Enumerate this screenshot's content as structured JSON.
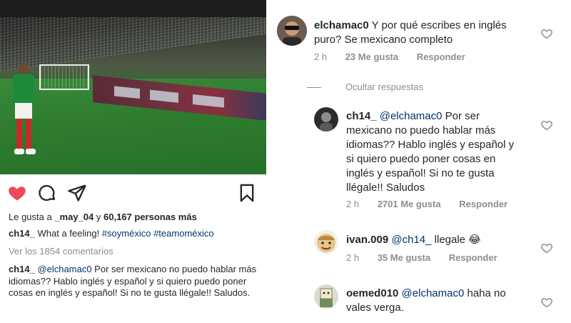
{
  "post": {
    "likes_prefix": "Le gusta a ",
    "likes_user": "_may_04",
    "likes_mid": " y ",
    "likes_count": "60,167 personas más",
    "caption_user": "ch14_",
    "caption_text": " What a feeling! ",
    "caption_tags": "#soyméxico #teamoméxico",
    "view_comments": "Ver los 1854 comentarios",
    "comment_user": "ch14_",
    "comment_mention": " @elchamac0",
    "comment_text": " Por ser mexicano no puedo hablar más idiomas?? Hablo inglés y español y si quiero puedo poner cosas en inglés y español! Si no te gusta llégale!! Saludos."
  },
  "icons": {
    "like": "heart-icon",
    "comment": "comment-icon",
    "share": "send-icon",
    "save": "bookmark-icon"
  },
  "colors": {
    "like_red": "#ed4956",
    "mention_blue": "#003569",
    "meta_gray": "#8e8e8e"
  },
  "comments": [
    {
      "user": "elchamac0",
      "text": " Y por qué escribes en inglés puro? Se mexicano completo",
      "time": "2 h",
      "likes": "23 Me gusta",
      "reply": "Responder"
    }
  ],
  "hide_replies": "Ocultar respuestas",
  "replies": [
    {
      "user": "ch14_",
      "mention": " @elchamac0",
      "text": " Por ser mexicano no puedo hablar más idiomas?? Hablo inglés y español y si quiero puedo poner cosas en inglés y español! Si no te gusta llégale!! Saludos",
      "time": "2 h",
      "likes": "2701 Me gusta",
      "reply": "Responder"
    },
    {
      "user": "ivan.009",
      "mention": " @ch14_",
      "text": " llegale 😂",
      "time": "2 h",
      "likes": "35 Me gusta",
      "reply": "Responder"
    },
    {
      "user": "oemed010",
      "mention": " @elchamac0",
      "text": " haha no vales verga.",
      "time": "2 h",
      "likes": "",
      "reply": ""
    }
  ]
}
